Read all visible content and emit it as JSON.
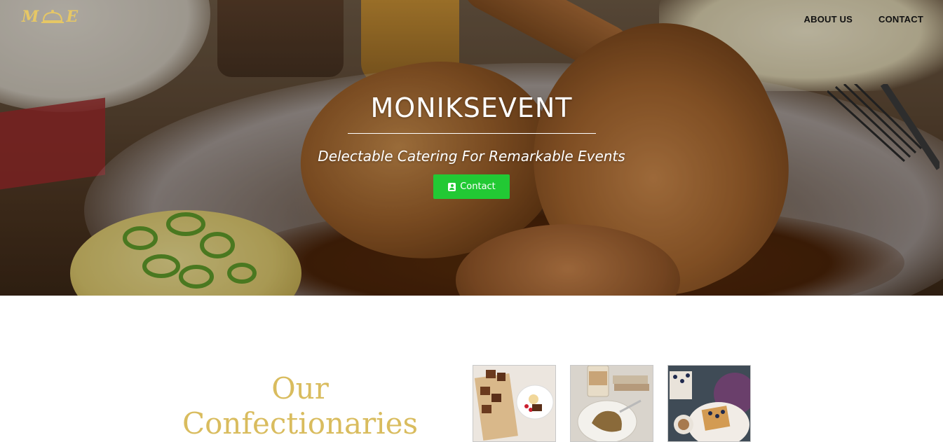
{
  "brand": {
    "logo_text": "M E"
  },
  "nav": {
    "items": [
      {
        "label": "ABOUT US"
      },
      {
        "label": "CONTACT"
      }
    ]
  },
  "hero": {
    "title": "MONIKSEVENT",
    "tagline": "Delectable Catering For Remarkable Events",
    "button_label": "Contact",
    "button_icon": "contact-card-icon",
    "button_color": "#22c934"
  },
  "section": {
    "title_line1": "Our",
    "title_line2": "Confectionaries",
    "title_color": "#d9bc5e"
  },
  "colors": {
    "accent_gold": "#e6c765",
    "nav_text": "#111111"
  }
}
